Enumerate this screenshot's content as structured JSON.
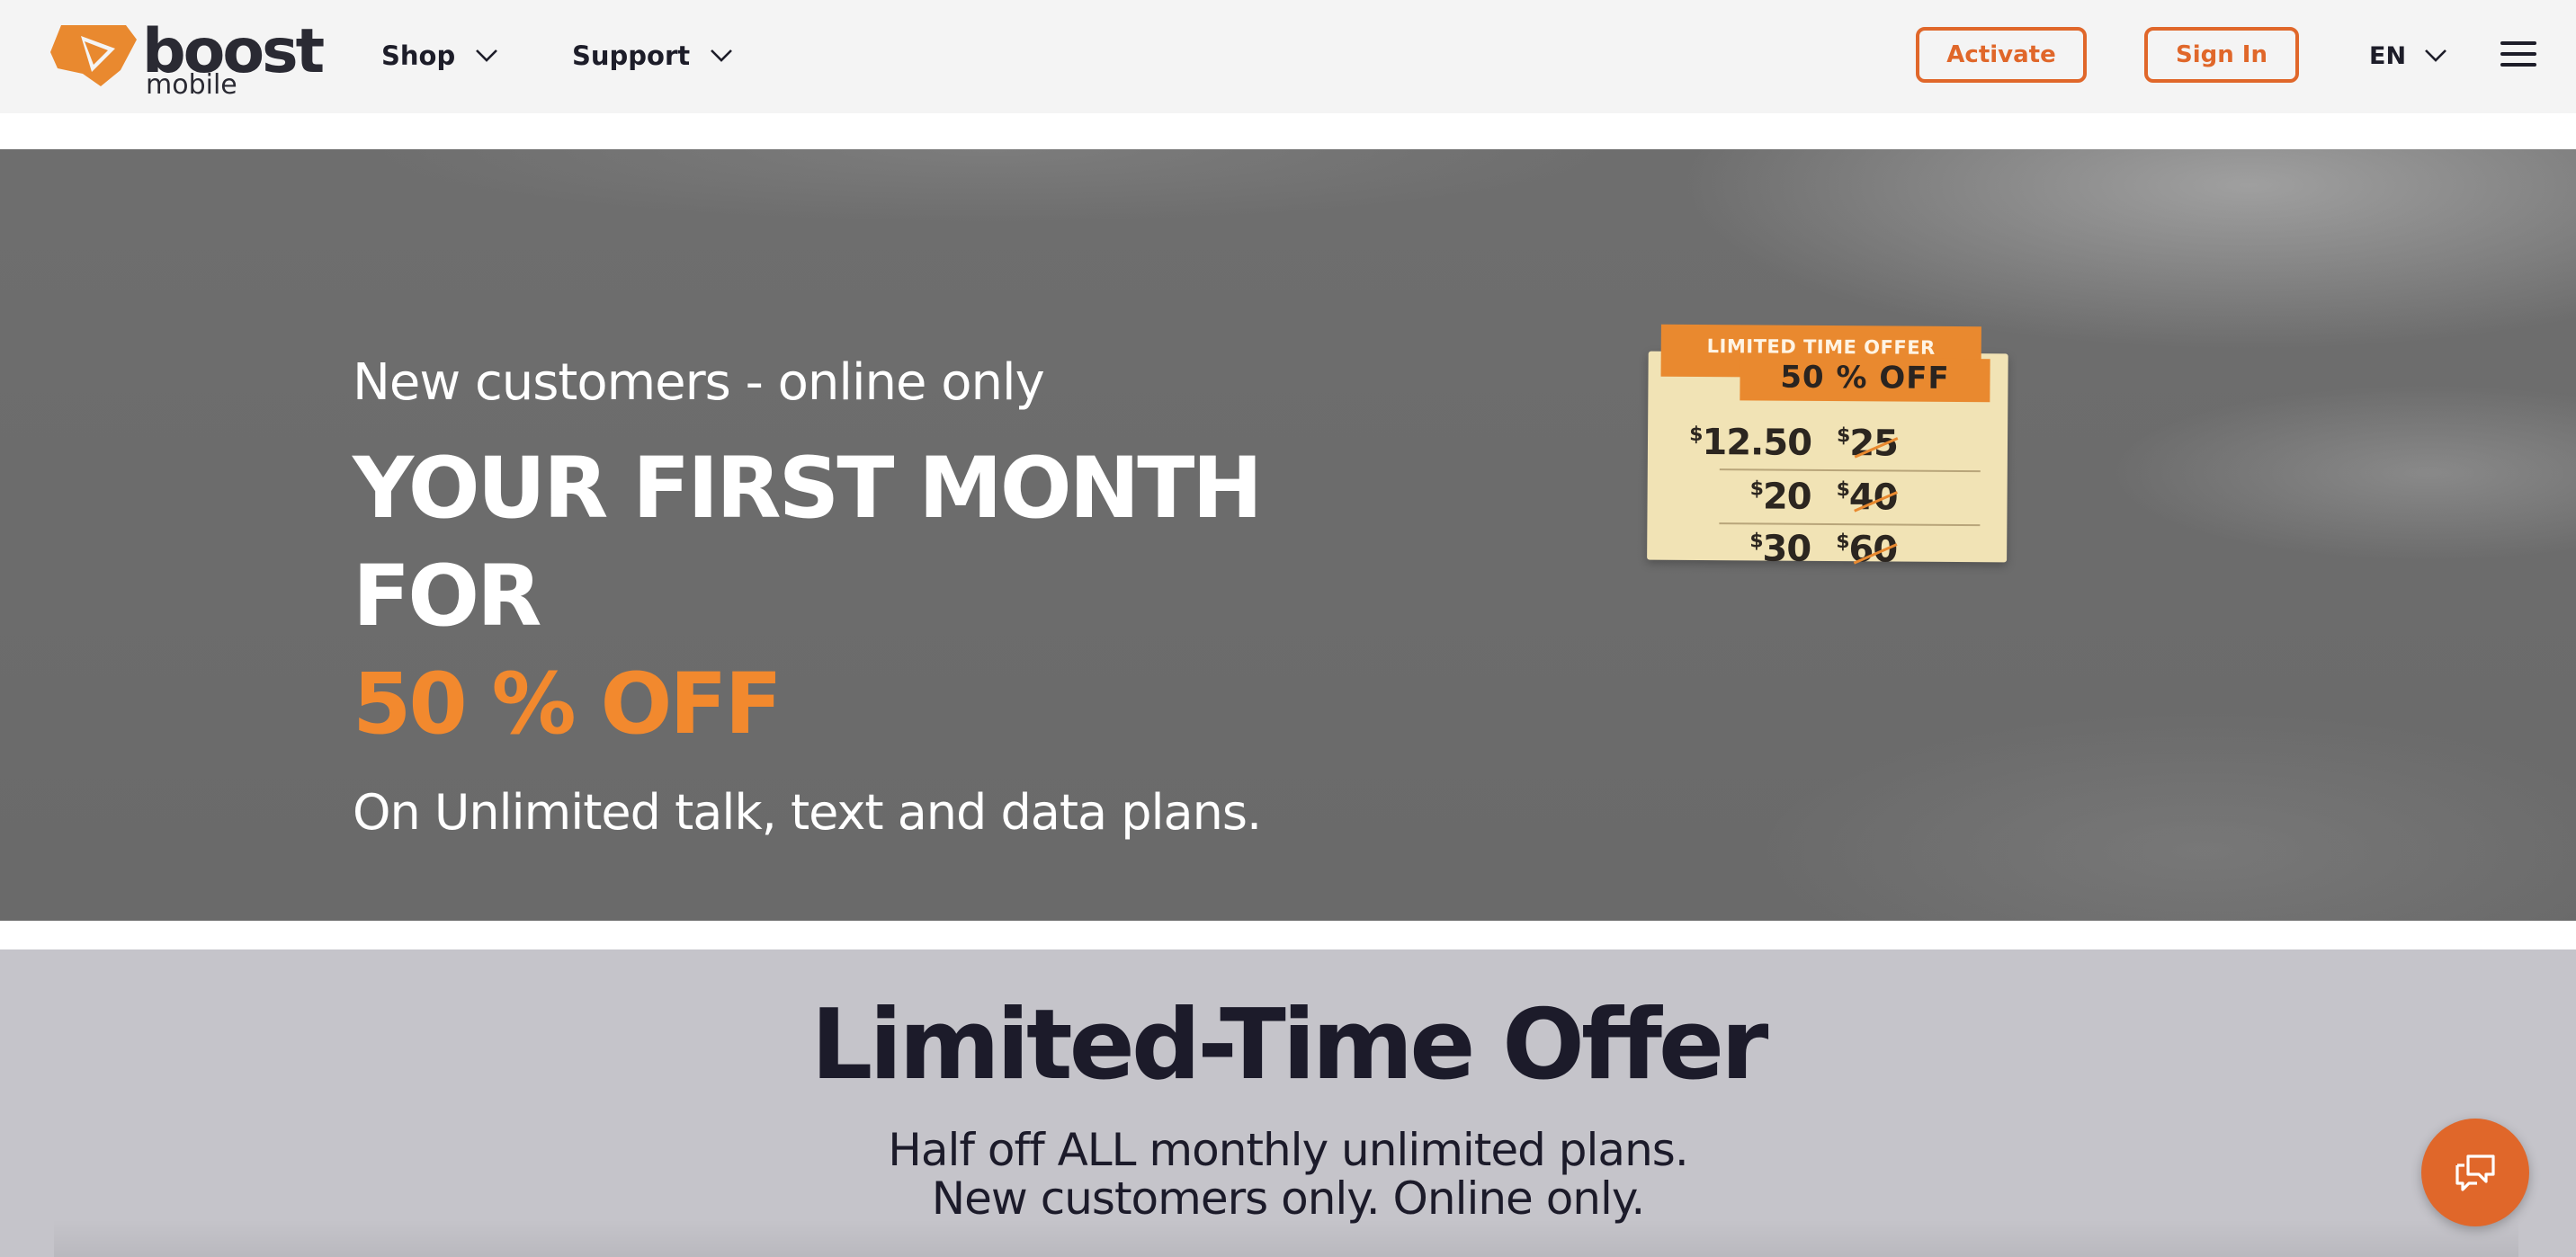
{
  "header": {
    "logo": {
      "word": "boost",
      "sub": "mobile",
      "brand_color": "#e0672a"
    },
    "nav": [
      {
        "label": "Shop",
        "icon": "chevron-down-icon"
      },
      {
        "label": "Support",
        "icon": "chevron-down-icon"
      }
    ],
    "activate_label": "Activate",
    "signin_label": "Sign In",
    "language": "EN",
    "menu_icon": "hamburger-menu-icon"
  },
  "hero": {
    "subtitle": "New customers - online only",
    "title_line1": "YOUR FIRST MONTH",
    "title_line2": "FOR",
    "title_accent": "50 % OFF",
    "description": "On Unlimited talk, text and data plans.",
    "accent_color": "#f2892e",
    "price_tag": {
      "label": "LIMITED TIME OFFER",
      "discount": "50 % OFF",
      "currency": "$",
      "rows": [
        {
          "new_price": "12.50",
          "old_price": "25"
        },
        {
          "new_price": "20",
          "old_price": "40"
        },
        {
          "new_price": "30",
          "old_price": "60"
        }
      ]
    }
  },
  "offer": {
    "title": "Limited-Time Offer",
    "line1": "Half off ALL monthly unlimited plans.",
    "line2": "New customers only. Online only."
  },
  "chat": {
    "icon": "chat-bubbles-icon",
    "color": "#e0672a"
  }
}
